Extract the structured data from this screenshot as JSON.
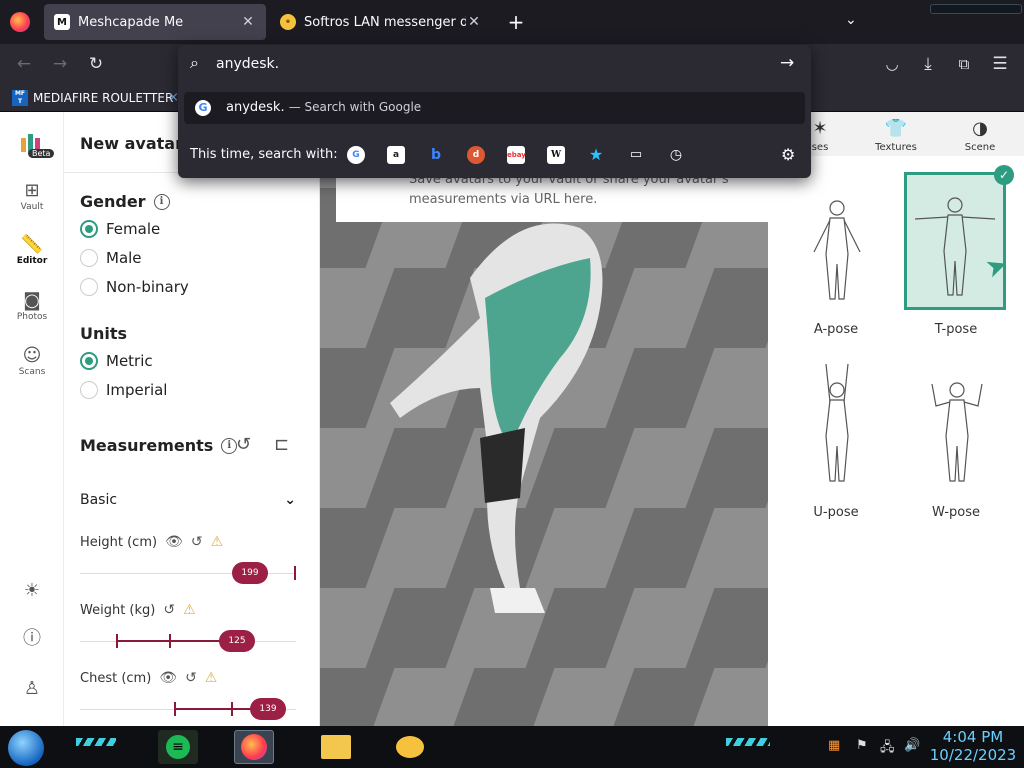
{
  "tabs": [
    {
      "title": "Meshcapade Me",
      "active": true
    },
    {
      "title": "Softros LAN messenger downl",
      "active": false
    }
  ],
  "toolbar": {
    "new_tab": "+"
  },
  "bookmarks": [
    {
      "label": "MEDIAFIRE ROULETTER",
      "icon_text": "MF T"
    }
  ],
  "urlbar": {
    "value": "anydesk.",
    "suggestion": {
      "text": "anydesk.",
      "action": "— Search with Google"
    },
    "search_with_label": "This time, search with:",
    "engines": [
      "google",
      "amazon",
      "bing",
      "duckduckgo",
      "ebay",
      "wikipedia",
      "bookmarks",
      "tabs",
      "history"
    ]
  },
  "rail": {
    "beta": "Beta",
    "items": [
      {
        "label": "Vault",
        "icon": "grid-icon"
      },
      {
        "label": "Editor",
        "icon": "ruler-icon"
      },
      {
        "label": "Photos",
        "icon": "camera-icon"
      },
      {
        "label": "Scans",
        "icon": "scan-face-icon"
      }
    ]
  },
  "panel": {
    "title": "New avatar",
    "gender": {
      "title": "Gender",
      "options": [
        "Female",
        "Male",
        "Non-binary"
      ],
      "selected": "Female"
    },
    "units": {
      "title": "Units",
      "options": [
        "Metric",
        "Imperial"
      ],
      "selected": "Metric"
    },
    "measurements": {
      "title": "Measurements",
      "basic_label": "Basic",
      "items": [
        {
          "label": "Height (cm)",
          "value": "199"
        },
        {
          "label": "Weight (kg)",
          "value": "125"
        },
        {
          "label": "Chest (cm)",
          "value": "139"
        }
      ]
    }
  },
  "viewport": {
    "banner": "Save avatars to your vault or share your avatar's measurements via URL here."
  },
  "right_panel": {
    "tabs": [
      {
        "label": "ses"
      },
      {
        "label": "Textures"
      },
      {
        "label": "Scene"
      }
    ],
    "poses": [
      {
        "label": "A-pose",
        "selected": false
      },
      {
        "label": "T-pose",
        "selected": true
      },
      {
        "label": "U-pose",
        "selected": false
      },
      {
        "label": "W-pose",
        "selected": false
      }
    ]
  },
  "taskbar": {
    "time": "4:04 PM",
    "date": "10/22/2023"
  },
  "colors": {
    "accent": "#2e9c80",
    "slider": "#9c1f45",
    "chrome": "#2b2a33"
  }
}
